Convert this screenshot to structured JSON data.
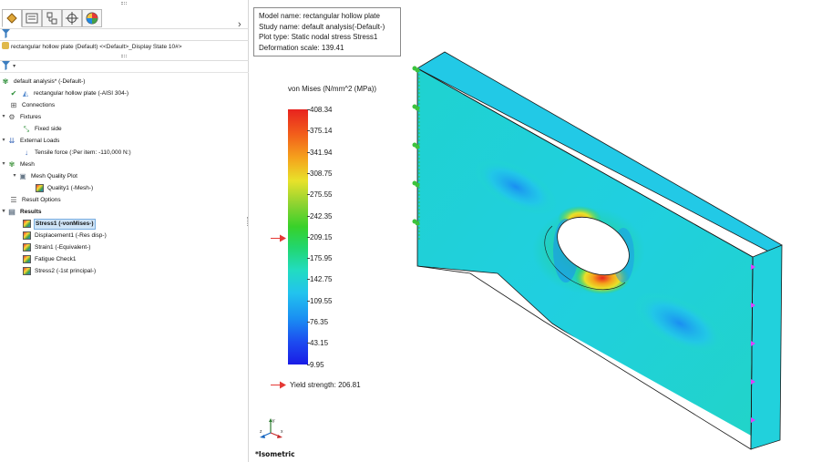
{
  "feature_manager": {
    "tabs": [
      "feature-tree",
      "property-manager",
      "configuration-manager",
      "dimxpert",
      "display-manager"
    ],
    "filter_icon": "filter-icon",
    "part_line": "rectangular hollow plate (Default) <<Default>_Display State 10#>"
  },
  "simulation_tree": {
    "study": "default analysis* (-Default-)",
    "part": "rectangular hollow plate (-AISI 304-)",
    "connections": "Connections",
    "fixtures": "Fixtures",
    "fixed_side": "Fixed side",
    "external_loads": "External Loads",
    "tensile_force": "Tensile force (:Per item: -110,000 N:)",
    "mesh": "Mesh",
    "mesh_quality_plot": "Mesh Quality Plot",
    "quality1": "Quality1 (-Mesh-)",
    "result_options": "Result Options",
    "results": "Results",
    "stress1": "Stress1 (-vonMises-)",
    "displacement1": "Displacement1 (-Res disp-)",
    "strain1": "Strain1 (-Equivalent-)",
    "fatigue_check1": "Fatigue Check1",
    "stress2": "Stress2 (-1st principal-)"
  },
  "plot_info": {
    "model_name": "Model name: rectangular hollow plate",
    "study_name": "Study name: default analysis(-Default-)",
    "plot_type": "Plot type: Static nodal stress Stress1",
    "deformation_scale": "Deformation scale: 139.41"
  },
  "legend": {
    "title": "von Mises (N/mm^2 (MPa))",
    "ticks": [
      "408.34",
      "375.14",
      "341.94",
      "308.75",
      "275.55",
      "242.35",
      "209.15",
      "175.95",
      "142.75",
      "109.55",
      "76.35",
      "43.15",
      "9.95"
    ],
    "yield_label": "Yield strength: 206.81",
    "yield_value": 206.81,
    "min": 9.95,
    "max": 408.34,
    "colors": {
      "max": "#e8231f",
      "mid": "#38d12a",
      "min": "#1a1ce6",
      "yield_arrow": "#e53935"
    }
  },
  "viewport": {
    "view_name": "*Isometric",
    "triad_axes": [
      "x",
      "y",
      "z"
    ]
  }
}
